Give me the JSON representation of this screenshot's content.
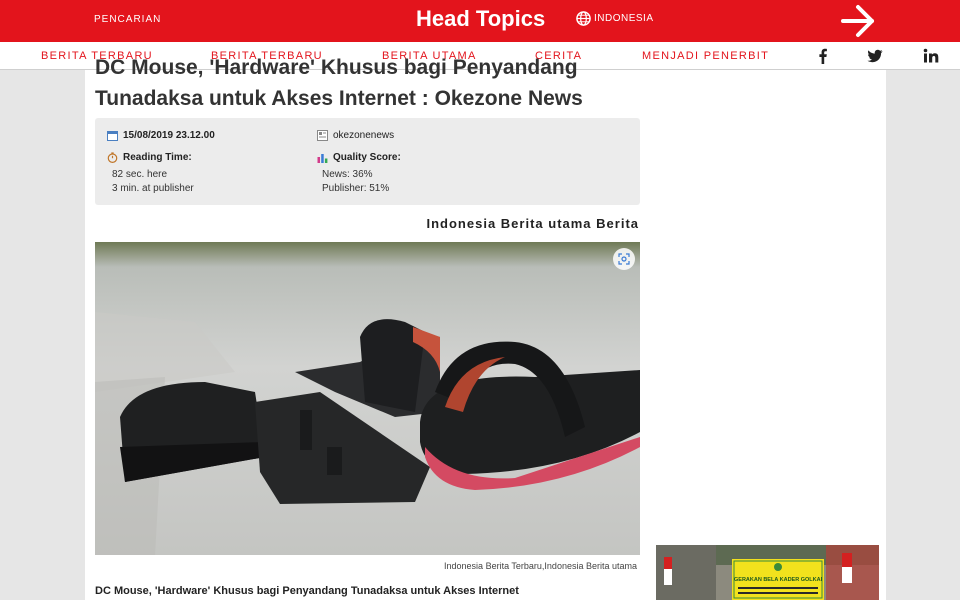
{
  "header": {
    "search_label": "PENCARIAN",
    "brand": "Head Topics",
    "region": "INDONESIA"
  },
  "nav": {
    "items": [
      {
        "label": "BERITA TERBARU"
      },
      {
        "label": "BERITA TERBARU"
      },
      {
        "label": "BERITA UTAMA"
      },
      {
        "label": "CERITA"
      },
      {
        "label": "MENJADI PENERBIT"
      }
    ],
    "social": [
      "facebook-icon",
      "twitter-icon",
      "linkedin-icon"
    ]
  },
  "article": {
    "title_line1": "DC Mouse, 'Hardware' Khusus bagi Penyandang",
    "title_line2": "Tunadaksa untuk Akses Internet : Okezone News",
    "date": "15/08/2019 23.12.00",
    "source": "okezonenews",
    "reading_time_label": "Reading Time:",
    "reading_here": "82 sec. here",
    "reading_publisher": "3 min. at publisher",
    "quality_label": "Quality Score:",
    "quality_news": "News: 36%",
    "quality_publisher": "Publisher: 51%",
    "categories": "Indonesia Berita utama Berita",
    "caption": "Indonesia Berita Terbaru,Indonesia Berita utama",
    "summary": "DC Mouse, 'Hardware' Khusus bagi Penyandang Tunadaksa untuk Akses Internet"
  },
  "ad": {
    "banner_text": "GERAKAN BELA KADER GOLKAR"
  },
  "colors": {
    "brand_red": "#e3141c"
  }
}
